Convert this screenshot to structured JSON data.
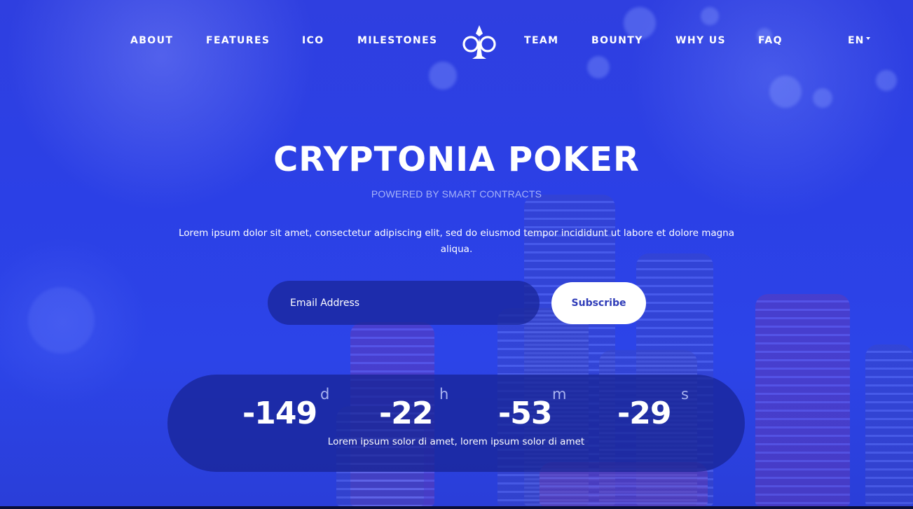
{
  "nav": {
    "items": [
      {
        "label": "ABOUT"
      },
      {
        "label": "FEATURES"
      },
      {
        "label": "ICO"
      },
      {
        "label": "MILESTONES"
      },
      {
        "label": "TEAM"
      },
      {
        "label": "BOUNTY"
      },
      {
        "label": "WHY US"
      },
      {
        "label": "FAQ"
      }
    ],
    "logo_icon": "club-spade-logo-icon",
    "language": "EN",
    "language_icon": "caret-down-icon"
  },
  "hero": {
    "title": "CRYPTONIA POKER",
    "subtitle": "POWERED BY SMART CONTRACTS",
    "description": "Lorem ipsum dolor sit amet, consectetur adipiscing elit, sed do eiusmod tempor incididunt ut labore et dolore magna aliqua."
  },
  "subscribe": {
    "placeholder": "Email Address",
    "button_label": "Subscribe"
  },
  "countdown": {
    "days": "-149",
    "days_unit": "d",
    "hours": "-22",
    "hours_unit": "h",
    "minutes": "-53",
    "minutes_unit": "m",
    "seconds": "-29",
    "seconds_unit": "s",
    "caption": "Lorem ipsum solor di amet, lorem ipsum solor di amet"
  },
  "colors": {
    "background": "#2c44e8",
    "subtitle": "#a8b4f8",
    "button_text": "#2e3bb8",
    "panel": "#16228f"
  }
}
